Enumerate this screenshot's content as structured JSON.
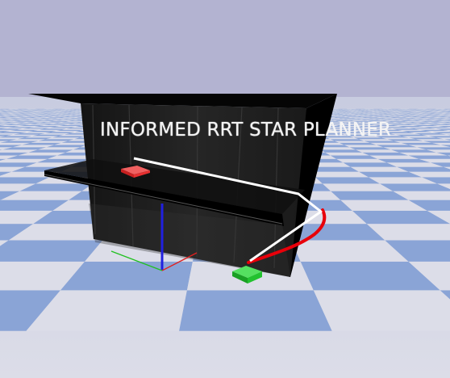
{
  "window": {
    "title_text": "INFORMED RRT STAR PLANNER"
  },
  "scene": {
    "sky_color": "#b3b3d1",
    "floor_light_color": "#dcdde8",
    "floor_blue_color": "#8aa4d6",
    "obstacle_color": "#1a1a1a",
    "shelf_color": "#0d0d0d",
    "start_marker_color": "#e53030",
    "goal_marker_color": "#22c22f",
    "path_color": "#ffffff",
    "tree_edge_color": "#e8000a",
    "axis_x_color": "#e02020",
    "axis_y_color": "#20c020",
    "axis_z_color": "#2020e0"
  }
}
